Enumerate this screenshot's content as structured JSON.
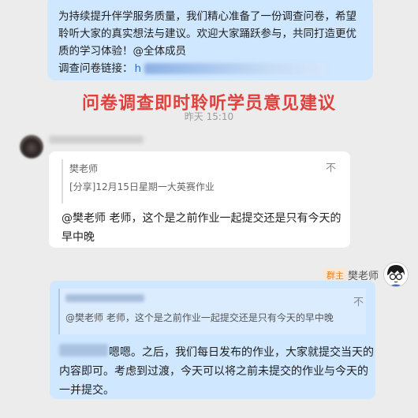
{
  "message_top": {
    "lines": [
      "为持续提升伴学服务质量，我们精心准备了一份调查问卷，希望",
      "聆听大家的真实想法与建议。欢迎大家踊跃参与，共同打造更优",
      "质的学习体验！@全体成员"
    ],
    "link_label": "调查问卷链接：",
    "link_start": "h"
  },
  "overlay_title": "问卷调查即时聆听学员意见建议",
  "timestamp": "昨天 15:10",
  "message_received": {
    "quote_author": "樊老师",
    "quote_text": "[分享]12月15日星期一大英赛作业",
    "close_icon": "不",
    "reply_lines": [
      "@樊老师 老师，这个是之前作业一起提交还是只有今天的",
      "早中晚"
    ]
  },
  "message_reply": {
    "badge": "群主",
    "sender": "樊老师",
    "quote_text": "@樊老师 老师，这个是之前作业一起提交还是只有今天的早中晚",
    "close_icon": "不",
    "answer_lines": [
      "嗯嗯。之后，我们每日发布的作业，大家就提交当天的",
      "内容即可。考虑到过渡，今天可以将之前未提交的作业与今天的",
      "一并提交。"
    ]
  },
  "colors": {
    "bubble_blue": "#cfe7ff",
    "overlay_red": "#e0413c",
    "badge_orange": "#e0842d"
  }
}
